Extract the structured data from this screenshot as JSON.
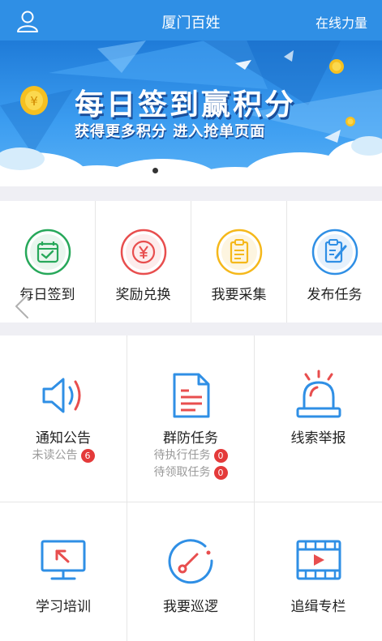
{
  "header": {
    "title": "厦门百姓",
    "right_link": "在线力量",
    "user_icon": "user-icon"
  },
  "banner": {
    "title": "每日签到赢积分",
    "subtitle": "获得更多积分 进入抢单页面",
    "page_indicator": {
      "total": 2,
      "active": 1
    }
  },
  "quick_actions": [
    {
      "label": "每日签到",
      "icon": "calendar-check-icon",
      "color": "#27a85a"
    },
    {
      "label": "奖励兑换",
      "icon": "yuan-icon",
      "color": "#e84e4e"
    },
    {
      "label": "我要采集",
      "icon": "clipboard-icon",
      "color": "#f5b81b"
    },
    {
      "label": "发布任务",
      "icon": "edit-task-icon",
      "color": "#2f8fe5"
    }
  ],
  "modules": [
    {
      "label": "通知公告",
      "icon": "speaker-icon",
      "subs": [
        {
          "text": "未读公告",
          "count": "6"
        }
      ]
    },
    {
      "label": "群防任务",
      "icon": "document-icon",
      "subs": [
        {
          "text": "待执行任务",
          "count": "0"
        },
        {
          "text": "待领取任务",
          "count": "0"
        }
      ]
    },
    {
      "label": "线索举报",
      "icon": "alarm-light-icon",
      "subs": []
    },
    {
      "label": "学习培训",
      "icon": "training-monitor-icon",
      "subs": []
    },
    {
      "label": "我要巡逻",
      "icon": "patrol-dial-icon",
      "subs": []
    },
    {
      "label": "追缉专栏",
      "icon": "video-film-icon",
      "subs": []
    }
  ],
  "colors": {
    "primary": "#2f8fe5",
    "accent_red": "#e84e4e",
    "badge": "#e43a3a"
  }
}
